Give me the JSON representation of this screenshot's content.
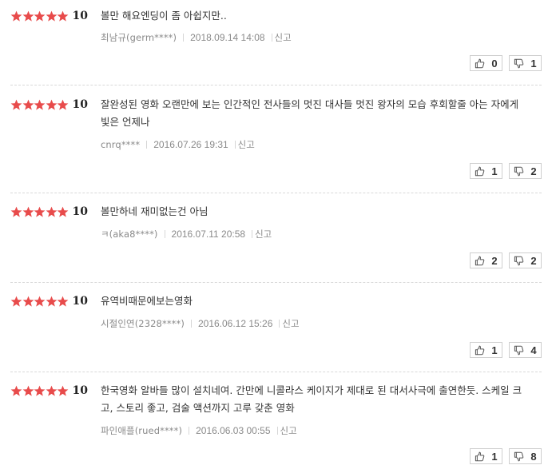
{
  "reviews": [
    {
      "score": "10",
      "stars": 5,
      "text": "볼만 해요엔딩이 좀 아쉽지만..",
      "author": "최남규(germ****)",
      "date": "2018.09.14 14:08",
      "report": "신고",
      "likes": "0",
      "dislikes": "1"
    },
    {
      "score": "10",
      "stars": 5,
      "text": "잘완성된 영화 오랜만에 보는 인간적인 전사들의 멋진 대사들 멋진 왕자의 모습 후회할줄 아는 자에게 빛은 언제나",
      "author": "cnrq****",
      "date": "2016.07.26 19:31",
      "report": "신고",
      "likes": "1",
      "dislikes": "2"
    },
    {
      "score": "10",
      "stars": 5,
      "text": "볼만하네 재미없는건 아님",
      "author": "ㅋ(aka8****)",
      "date": "2016.07.11 20:58",
      "report": "신고",
      "likes": "2",
      "dislikes": "2"
    },
    {
      "score": "10",
      "stars": 5,
      "text": "유역비때문에보는영화",
      "author": "시절인연(2328****)",
      "date": "2016.06.12 15:26",
      "report": "신고",
      "likes": "1",
      "dislikes": "4"
    },
    {
      "score": "10",
      "stars": 5,
      "text": "한국영화 알바들 많이 설치네여. 간만에 니콜라스 케이지가 제대로 된 대서사극에 출연한듯. 스케일 크고, 스토리 좋고, 검술 액션까지 고루 갖춘 영화",
      "author": "파인애플(rued****)",
      "date": "2016.06.03 00:55",
      "report": "신고",
      "likes": "1",
      "dislikes": "8"
    }
  ],
  "colors": {
    "star": "#e84b4b",
    "text": "#333333",
    "meta": "#8a8a8a",
    "border": "#cfcfcf"
  },
  "icons": {
    "star": "star-icon",
    "like": "thumbs-up-icon",
    "dislike": "thumbs-down-icon"
  }
}
